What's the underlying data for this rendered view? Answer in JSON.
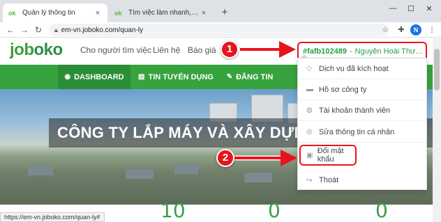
{
  "browser": {
    "tabs": [
      {
        "favicon": "ok",
        "title": "Quản lý thông tin",
        "close": "×"
      },
      {
        "favicon": "ok",
        "title": "Tìm việc làm nhanh, tạo cv trực tu",
        "close": "×"
      }
    ],
    "new_tab": "+",
    "window_controls": [
      "—",
      "☐",
      "✕"
    ],
    "url": "em-vn.joboko.com/quan-ly",
    "profile_initial": "N"
  },
  "site": {
    "logo_prefix": "job",
    "logo_suffix": "oko",
    "top_nav": [
      "Cho người tìm việc",
      "Liên hệ",
      "Báo giá"
    ],
    "user_id": "#fafb102489",
    "user_sep": "-",
    "user_name": "Nguyễn Hoài Thươn...",
    "green_nav": [
      {
        "icon": "dashboard-icon",
        "label": "DASHBOARD"
      },
      {
        "icon": "newspaper-icon",
        "label": "TIN TUYỂN DỤNG"
      },
      {
        "icon": "edit-icon",
        "label": "ĐĂNG TIN"
      }
    ],
    "hero_title": "CÔNG TY LẮP MÁY VÀ XÂY DỰNG",
    "stats": [
      "10",
      "0",
      "0"
    ]
  },
  "dropdown": {
    "items": [
      {
        "icon": "diamond-icon",
        "label": "Dịch vụ đã kích hoạt"
      },
      {
        "icon": "briefcase-icon",
        "label": "Hồ sơ công ty"
      },
      {
        "icon": "users-icon",
        "label": "Tài khoản thành viên"
      },
      {
        "icon": "user-edit-icon",
        "label": "Sửa thông tin cá nhân"
      },
      {
        "icon": "lock-icon",
        "label": "Đổi mật khẩu"
      },
      {
        "icon": "logout-icon",
        "label": "Thoát"
      }
    ]
  },
  "annotations": {
    "step1": "1",
    "step2": "2"
  },
  "status_url": "https://em-vn.joboko.com/quan-ly#",
  "colors": {
    "brand_green": "#37a33e",
    "annotation_red": "#e8141c"
  }
}
